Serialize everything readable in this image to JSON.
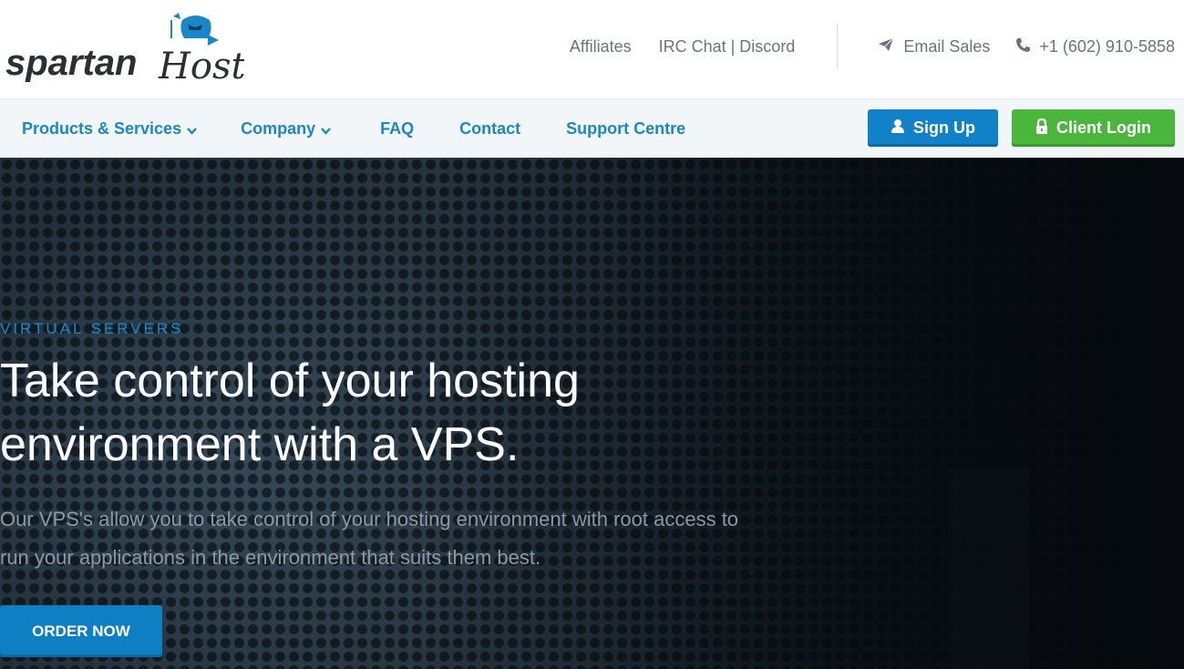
{
  "brand": {
    "name_part1": "spartan",
    "name_part2": "Host"
  },
  "topbar": {
    "links": [
      "Affiliates",
      "IRC Chat | Discord"
    ],
    "email_label": "Email Sales",
    "phone_label": "+1 (602) 910-5858"
  },
  "nav": {
    "items": [
      "Products & Services",
      "Company",
      "FAQ",
      "Contact",
      "Support Centre"
    ],
    "signup_label": "Sign Up",
    "login_label": "Client Login"
  },
  "hero": {
    "eyebrow": "VIRTUAL SERVERS",
    "headline": "Take control of your hosting environment with a VPS.",
    "subtext": "Our VPS's allow you to take control of your hosting environment with root access to run your applications in the environment that suits them best.",
    "cta_label": "ORDER NOW"
  },
  "colors": {
    "brand_blue": "#1a87c9",
    "signup_button": "#1181c8",
    "login_button": "#4ab63b",
    "hero_dark": "#1b2630"
  },
  "icons": {
    "email": "paper-plane-icon",
    "phone": "phone-icon",
    "signup": "user-icon",
    "login": "lock-icon",
    "dropdown": "chevron-down-icon",
    "logo_mascot": "spartan-helmet-icon"
  }
}
